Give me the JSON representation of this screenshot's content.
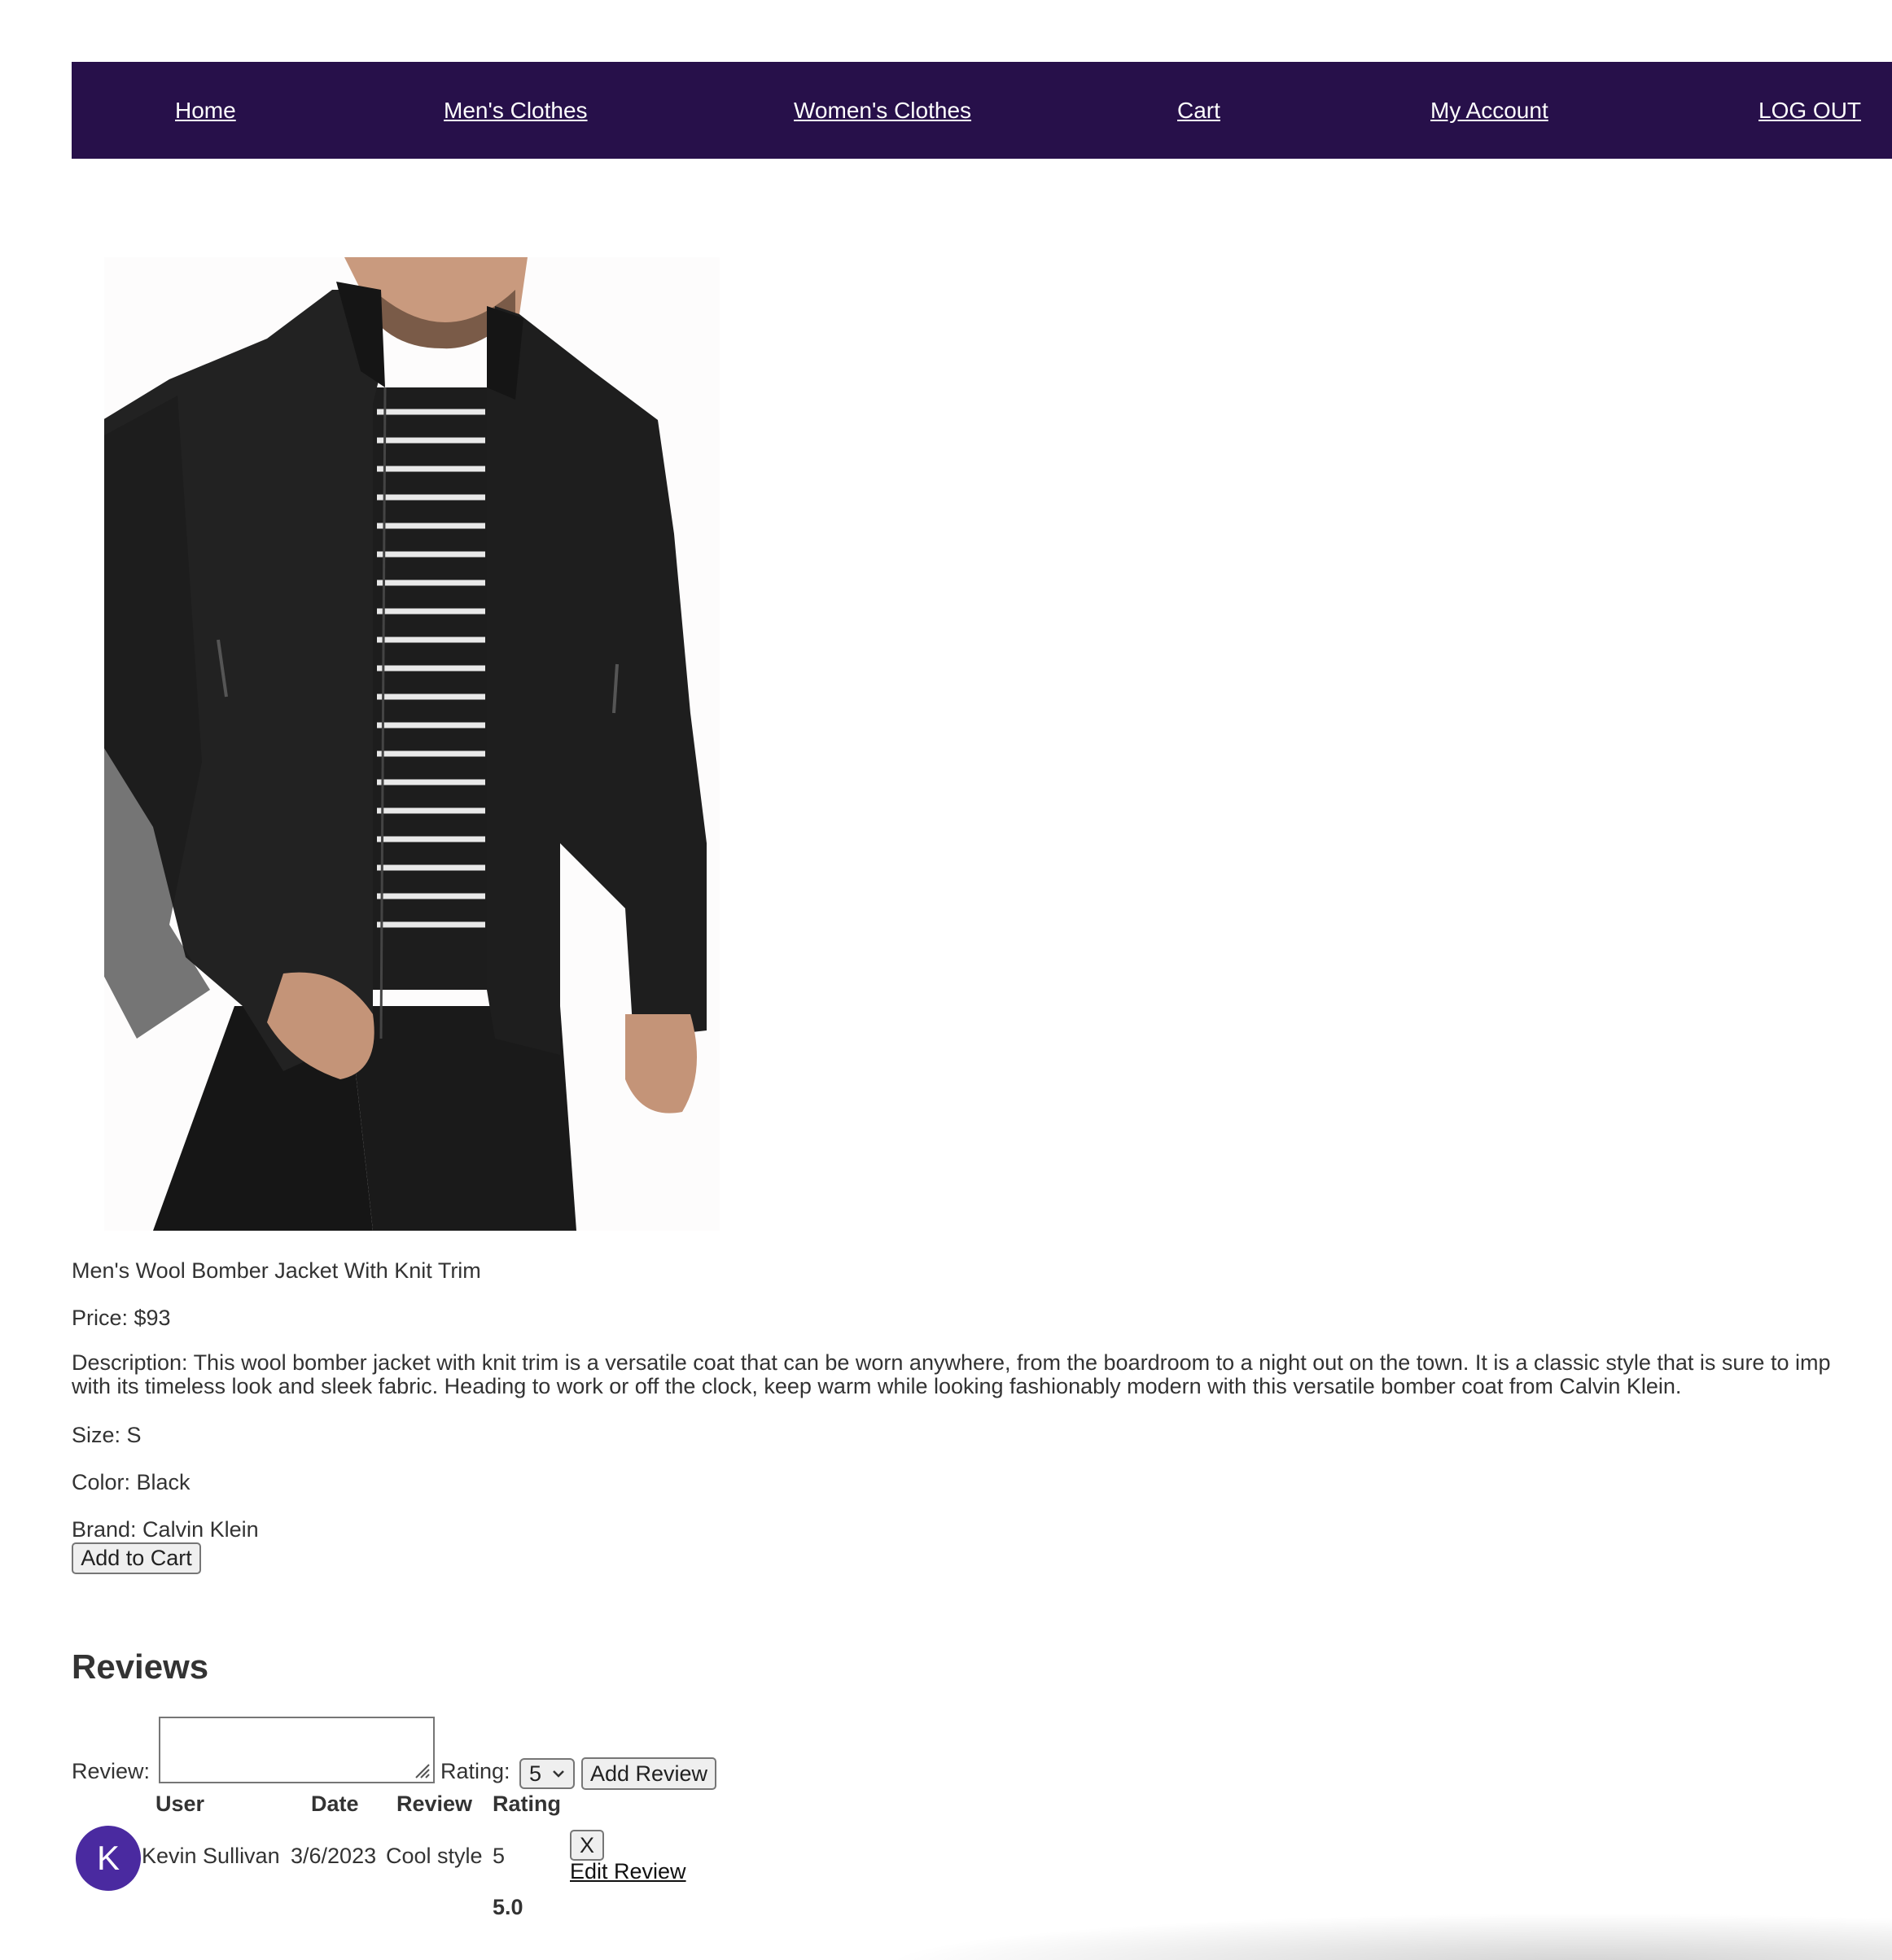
{
  "nav": {
    "home": "Home",
    "mens": "Men's Clothes",
    "womens": "Women's Clothes",
    "cart": "Cart",
    "account": "My Account",
    "logout": "LOG OUT"
  },
  "product": {
    "image_alt": "Men's wool bomber jacket worn by model",
    "name": "Men's Wool Bomber Jacket With Knit Trim",
    "price": "Price: $93",
    "description_line1": "Description: This wool bomber jacket with knit trim is a versatile coat that can be worn anywhere, from the boardroom to a night out on the town. It is a classic style that is sure to imp",
    "description_line2": "with its timeless look and sleek fabric. Heading to work or off the clock, keep warm while looking fashionably modern with this versatile bomber coat from Calvin Klein.",
    "size": "Size: S",
    "color": "Color: Black",
    "brand": "Brand: Calvin Klein",
    "add_to_cart": "Add to Cart"
  },
  "reviews": {
    "title": "Reviews",
    "review_label": "Review:",
    "review_value": "",
    "rating_label": "Rating:",
    "rating_selected": "5",
    "add_review": "Add Review",
    "columns": {
      "user": "User",
      "date": "Date",
      "review": "Review",
      "rating": "Rating"
    },
    "rows": [
      {
        "avatar_letter": "K",
        "user": "Kevin Sullivan",
        "date": "3/6/2023",
        "review": "Cool style",
        "rating": "5",
        "delete": "X",
        "edit": "Edit Review"
      }
    ],
    "average": "5.0"
  },
  "colors": {
    "nav_bg": "#27104a",
    "avatar_bg": "#4a2aa0"
  }
}
